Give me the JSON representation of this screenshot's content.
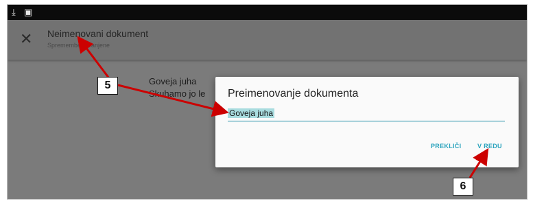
{
  "status_bar": {
    "icons": [
      "download-icon",
      "image-icon"
    ]
  },
  "app_bar": {
    "close_glyph": "✕",
    "document_title": "Neimenovani dokument",
    "subtitle": "Spremembe shranjene"
  },
  "document": {
    "line1": "Goveja juha",
    "line2": "Skuhamo jo le"
  },
  "dialog": {
    "title": "Preimenovanje dokumenta",
    "input_value": "Goveja juha",
    "cancel_label": "PREKLIČI",
    "ok_label": "V REDU"
  },
  "annotations": {
    "callout_5": "5",
    "callout_6": "6",
    "arrow_color": "#cc0000"
  },
  "colors": {
    "accent": "#2aa3bd",
    "selection": "#a9dcdf"
  }
}
